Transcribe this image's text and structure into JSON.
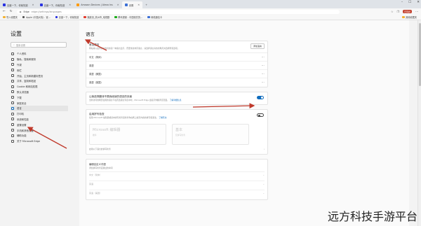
{
  "browser": {
    "tabs": [
      {
        "title": "百度一下，你就知道",
        "active": false,
        "favicon_color": "#2932e1"
      },
      {
        "title": "百度一下，你就知道",
        "active": false,
        "favicon_color": "#2932e1"
      },
      {
        "title": "Amazon Devices | Alexa Ins",
        "active": false,
        "favicon_color": "#ff9900"
      },
      {
        "title": "设置",
        "active": true,
        "favicon_color": "#3b6fd6"
      }
    ],
    "new_tab_symbol": "+",
    "url_prefix": "Edge",
    "url_path": "edge://settings/languages",
    "profile_label": "已同步",
    "favorites": [
      {
        "label": "导入收藏夹",
        "color": "#f2b233"
      },
      {
        "label": "Apple (中国大陆) - 官...",
        "color": "#555555"
      },
      {
        "label": "百度一下，你就知道",
        "color": "#2932e1"
      },
      {
        "label": "播放页_杭州市_电视剧",
        "color": "#e33b2e"
      },
      {
        "label": "腾讯视频 - 中国领先的...",
        "color": "#1aad19"
      },
      {
        "label": "网络通信卡",
        "color": "#3b6fd6"
      },
      {
        "label": "其他收藏夹",
        "color": "#f2b233"
      }
    ]
  },
  "sidebar": {
    "title": "设置",
    "search_placeholder": "搜索设置",
    "items": [
      {
        "label": "个人资料",
        "active": false
      },
      {
        "label": "隐私、搜索和服务",
        "active": false
      },
      {
        "label": "外观",
        "active": false
      },
      {
        "label": "侧栏",
        "active": false
      },
      {
        "label": "开始、主页和新建标签页",
        "active": false
      },
      {
        "label": "共享、复制和粘贴",
        "active": false
      },
      {
        "label": "Cookie 和网站权限",
        "active": false
      },
      {
        "label": "默认浏览器",
        "active": false
      },
      {
        "label": "下载",
        "active": false
      },
      {
        "label": "家庭安全",
        "active": false
      },
      {
        "label": "语言",
        "active": true
      },
      {
        "label": "打印机",
        "active": false
      },
      {
        "label": "系统和性能",
        "active": false
      },
      {
        "label": "重置设置",
        "active": false
      },
      {
        "label": "手机和其他设备",
        "active": false
      },
      {
        "label": "辅助功能",
        "active": false
      },
      {
        "label": "关于 Microsoft Edge",
        "active": false
      }
    ]
  },
  "main": {
    "title": "语言",
    "preferred": {
      "heading": "首选语言",
      "description": "网站将以此列表中支持的第一种语言显示。若要重新排序语言，请选择语言旁的省略号并选择所需选项。",
      "add_button": "添加语言",
      "languages": [
        "中文（简体）",
        "英语",
        "英语（美国）",
        "英语（英国）"
      ],
      "more_symbol": "···"
    },
    "translate": {
      "heading": "让我选择翻译不是我阅读的语言的页面",
      "description": "当你访问的网页使用的语言不在首选语言列表中时，Microsoft Edge 会提示你翻译该页面。",
      "link": "了解详细信息",
      "enabled": true
    },
    "spellcheck": {
      "heading": "启用拼写检查",
      "description": "使用 Microsoft 编辑器或基本拼写检查来检查你在网上编写内容的拼写和语法。",
      "link": "了解有关",
      "enabled": false,
      "options": [
        {
          "name": "Microsoft 编辑器",
          "sub": "推荐"
        },
        {
          "name": "基本",
          "sub": "仅拼写检查"
        }
      ],
      "note": "启用以下语言的拼写检查"
    },
    "custom": {
      "heading": "编辑自定义词语",
      "sub": "添加拼写检查应跳过的单词",
      "rows": [
        "中文（简体）",
        "英语",
        "英语（美国）"
      ]
    }
  },
  "watermark": "远方科技手游平台",
  "colors": {
    "accent": "#0f6cbd",
    "annotation_red": "#c0392b"
  }
}
